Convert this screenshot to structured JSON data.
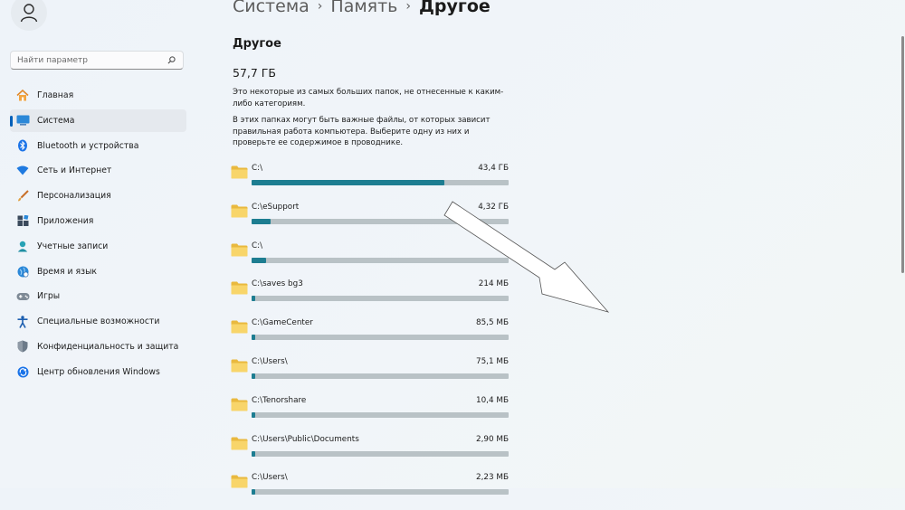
{
  "breadcrumb": {
    "items": [
      "Система",
      "Память"
    ],
    "current": "Другое"
  },
  "search": {
    "placeholder": "Найти параметр"
  },
  "sidebar": {
    "items": [
      {
        "label": "Главная",
        "icon": "home-icon",
        "active": false
      },
      {
        "label": "Система",
        "icon": "display-icon",
        "active": true
      },
      {
        "label": "Bluetooth и устройства",
        "icon": "bluetooth-icon",
        "active": false
      },
      {
        "label": "Сеть и Интернет",
        "icon": "wifi-icon",
        "active": false
      },
      {
        "label": "Персонализация",
        "icon": "brush-icon",
        "active": false
      },
      {
        "label": "Приложения",
        "icon": "apps-icon",
        "active": false
      },
      {
        "label": "Учетные записи",
        "icon": "user-icon",
        "active": false
      },
      {
        "label": "Время и язык",
        "icon": "globe-clock-icon",
        "active": false
      },
      {
        "label": "Игры",
        "icon": "gamepad-icon",
        "active": false
      },
      {
        "label": "Специальные возможности",
        "icon": "accessibility-icon",
        "active": false
      },
      {
        "label": "Конфиденциальность и защита",
        "icon": "shield-icon",
        "active": false
      },
      {
        "label": "Центр обновления Windows",
        "icon": "update-icon",
        "active": false
      }
    ]
  },
  "main": {
    "title": "Другое",
    "total": "57,7 ГБ",
    "desc1": "Это некоторые из самых больших папок, не отнесенные к каким-либо категориям.",
    "desc2": "В этих папках могут быть важные файлы, от которых зависит правильная работа компьютера. Выберите одну из них и проверьте ее содержимое в проводнике.",
    "folders": [
      {
        "path": "C:\\",
        "size": "43,4 ГБ",
        "fraction": 0.75
      },
      {
        "path": "C:\\eSupport",
        "size": "4,32 ГБ",
        "fraction": 0.075
      },
      {
        "path": "C:\\",
        "size": "",
        "fraction": 0.058
      },
      {
        "path": "C:\\saves bg3",
        "size": "214 МБ",
        "fraction": 0.012
      },
      {
        "path": "C:\\GameCenter",
        "size": "85,5 МБ",
        "fraction": 0.009
      },
      {
        "path": "C:\\Users\\",
        "size": "75,1 МБ",
        "fraction": 0.009
      },
      {
        "path": "C:\\Tenorshare",
        "size": "10,4 МБ",
        "fraction": 0.008
      },
      {
        "path": "C:\\Users\\Public\\Documents",
        "size": "2,90 МБ",
        "fraction": 0.008
      },
      {
        "path": "C:\\Users\\",
        "size": "2,23 МБ",
        "fraction": 0.008
      }
    ]
  },
  "colors": {
    "accent": "#005fb8",
    "bar_fill": "#1d7d91",
    "bar_track": "#b9c2c6",
    "folder": "#f8d56a"
  }
}
